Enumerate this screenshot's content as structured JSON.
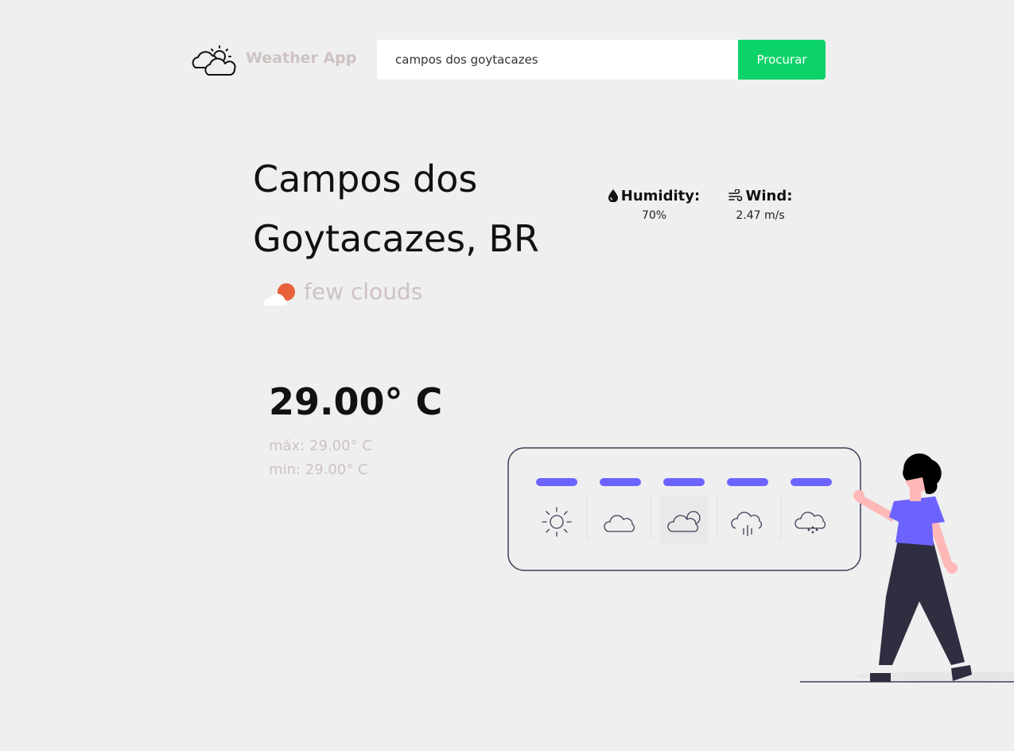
{
  "app": {
    "title": "Weather App",
    "logo_icon": "cloud-sun-icon"
  },
  "search": {
    "value": "campos dos goytacazes",
    "button_label": "Procurar"
  },
  "weather": {
    "city_line1": "Campos dos",
    "city_line2": "Goytacazes, BR",
    "description": "few clouds",
    "description_icon": "few-clouds-icon",
    "humidity_label": "Humidity:",
    "humidity_value": "70%",
    "wind_label": "Wind:",
    "wind_value": "2.47 m/s",
    "temperature": "29.00° C",
    "max": "máx: 29.00° C",
    "min": "min: 29.00° C"
  },
  "colors": {
    "background": "#efefef",
    "accent_green": "#0cd368",
    "muted_text": "#cfc2c2",
    "illustration_purple": "#6c63ff",
    "illustration_dark": "#2f2e41",
    "desc_icon_orange": "#e8603c"
  },
  "illustration_icons": [
    "sun-icon",
    "cloud-icon",
    "cloud-sun-icon",
    "rain-icon",
    "snow-icon"
  ]
}
